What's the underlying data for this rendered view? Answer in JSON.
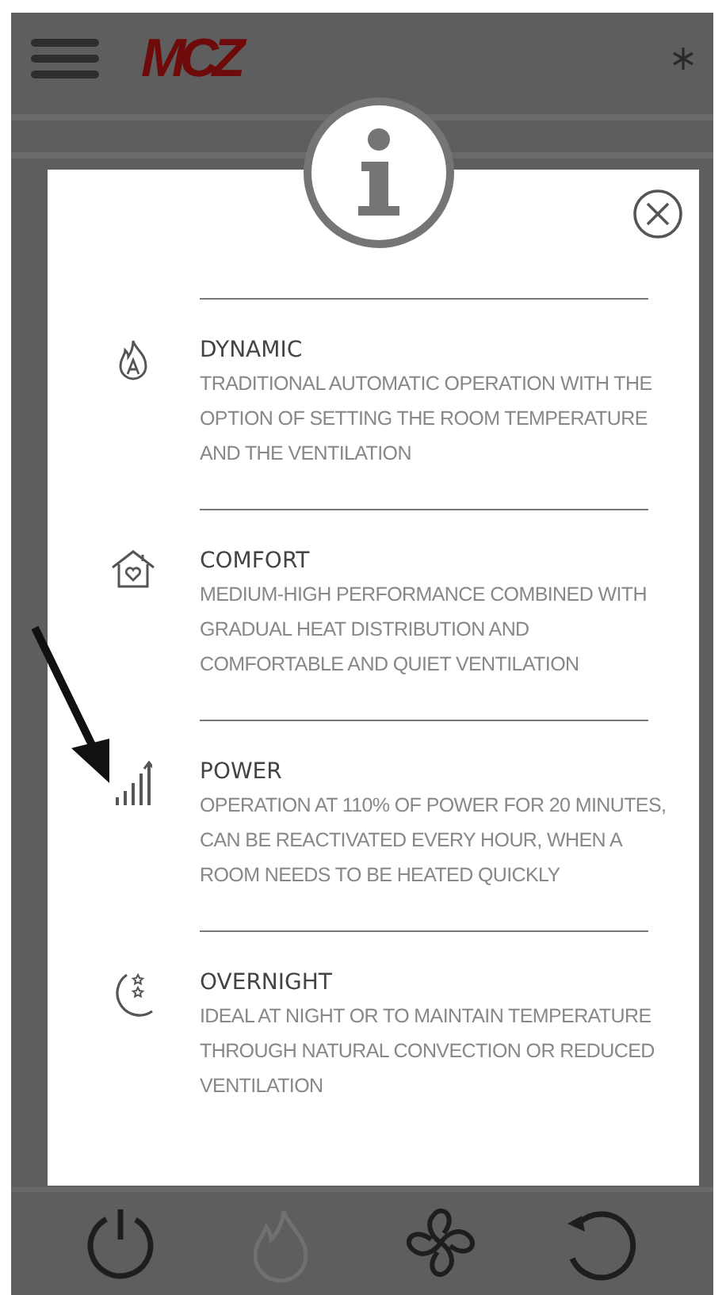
{
  "header": {
    "logo": "MCZ"
  },
  "dialog": {
    "modes": [
      {
        "kind": "dynamic",
        "title": "DYNAMIC",
        "description": "TRADITIONAL AUTOMATIC OPERATION WITH THE OPTION OF SETTING THE ROOM TEMPERATURE AND THE VENTILATION"
      },
      {
        "kind": "comfort",
        "title": "COMFORT",
        "description": "MEDIUM-HIGH PERFORMANCE COMBINED WITH GRADUAL HEAT DISTRIBUTION AND COMFORTABLE AND QUIET VENTILATION"
      },
      {
        "kind": "power",
        "title": "POWER",
        "description": "OPERATION AT 110% OF POWER FOR 20 MINUTES, CAN BE REACTIVATED EVERY HOUR, WHEN A ROOM NEEDS TO BE HEATED QUICKLY"
      },
      {
        "kind": "overnight",
        "title": "OVERNIGHT",
        "description": "IDEAL AT NIGHT OR TO MAINTAIN TEMPERATURE THROUGH NATURAL CONVECTION OR REDUCED VENTILATION"
      }
    ]
  },
  "toolbar": [
    {
      "kind": "power",
      "disabled": false
    },
    {
      "kind": "flame",
      "disabled": true
    },
    {
      "kind": "fan",
      "disabled": false
    },
    {
      "kind": "refresh",
      "disabled": false
    }
  ]
}
